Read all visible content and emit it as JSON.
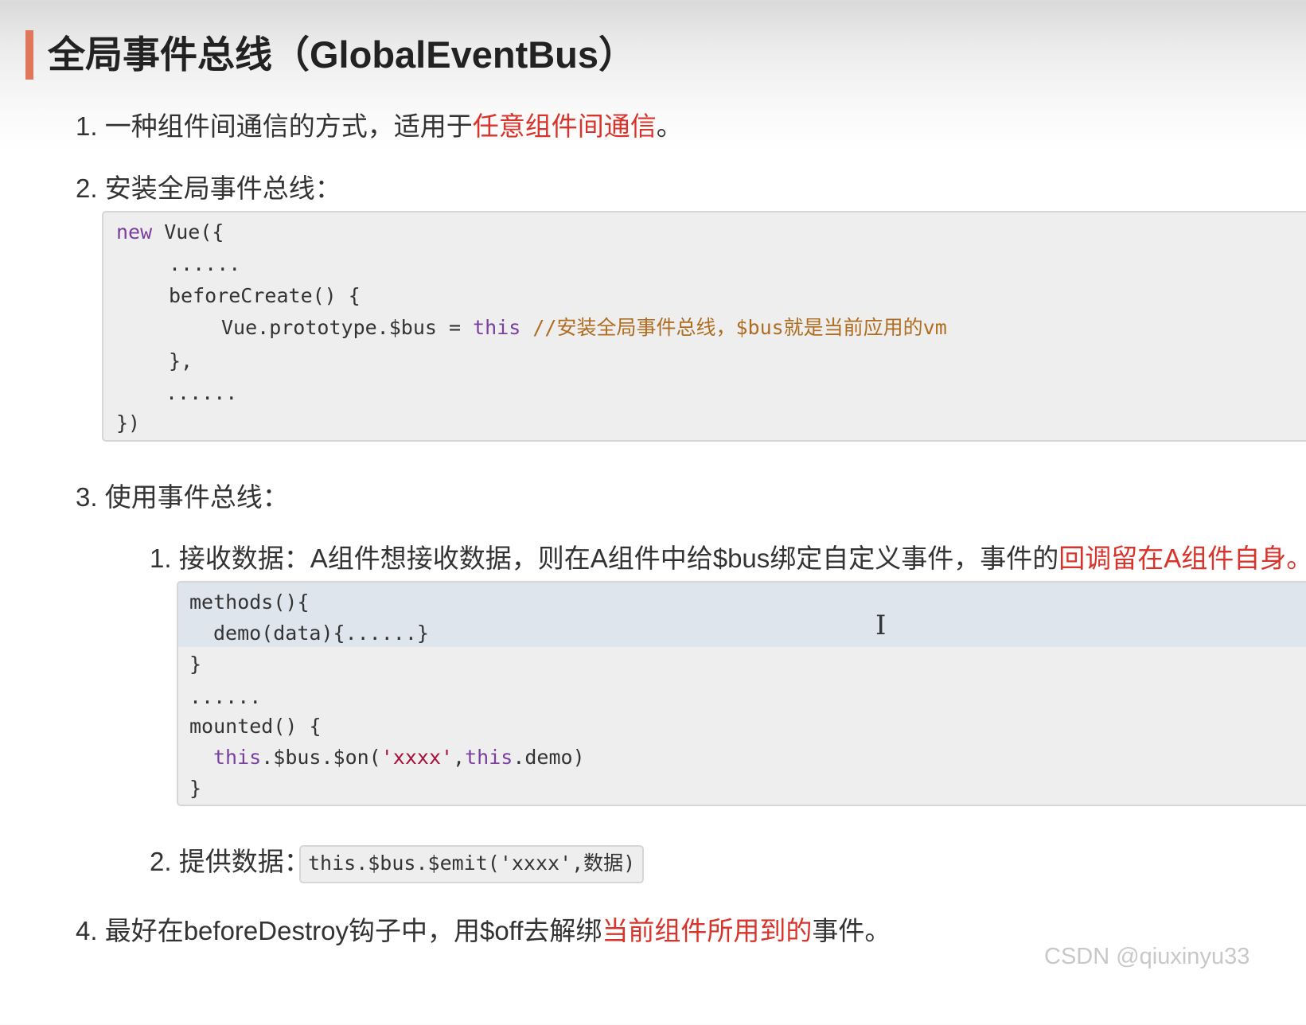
{
  "title": "全局事件总线（GlobalEventBus）",
  "items": [
    {
      "num": "1.",
      "text": "一种组件间通信的方式，适用于",
      "emphasis": "任意组件间通信",
      "suffix": "。"
    },
    {
      "num": "2.",
      "text": "安装全局事件总线："
    },
    {
      "num": "3.",
      "text": "使用事件总线："
    },
    {
      "num": "4.",
      "text": "最好在beforeDestroy钩子中，用$off去解绑",
      "emphasis": "当前组件所用到的",
      "suffix": "事件。"
    }
  ],
  "install_code": {
    "l1_kw": "new",
    "l1_rest": " Vue({",
    "l2": "......",
    "l3": "beforeCreate() {",
    "l4_a": "Vue.prototype.$bus ",
    "l4_op": "=",
    "l4_kw": " this",
    "l4_comment": " //安装全局事件总线，$bus就是当前应用的vm",
    "l5": "},",
    "l6": "......",
    "l7": "})"
  },
  "subitems": [
    {
      "num": "1.",
      "text": "接收数据：A组件想接收数据，则在A组件中给$bus绑定自定义事件，事件的",
      "emphasis": "回调留在A组件自身。"
    },
    {
      "num": "2.",
      "text": "提供数据："
    }
  ],
  "receive_code": {
    "l1": "methods(){",
    "l2": "demo(data){......}",
    "l3": "}",
    "l4": "......",
    "l5": "mounted() {",
    "l6_kw1": "this",
    "l6_a": ".$bus.$on(",
    "l6_str": "'xxxx'",
    "l6_b": ",",
    "l6_kw2": "this",
    "l6_c": ".demo)",
    "l7": "}"
  },
  "emit_code": "this.$bus.$emit('xxxx',数据)",
  "cursor_glyph": "I",
  "watermark": "CSDN @qiuxinyu33",
  "colors": {
    "accent_bar": "#e0765a",
    "emphasis_red": "#d9342b",
    "keyword": "#7b3f9e",
    "comment": "#b06d20",
    "string": "#a8123c",
    "code_bg": "#eeeeee"
  }
}
